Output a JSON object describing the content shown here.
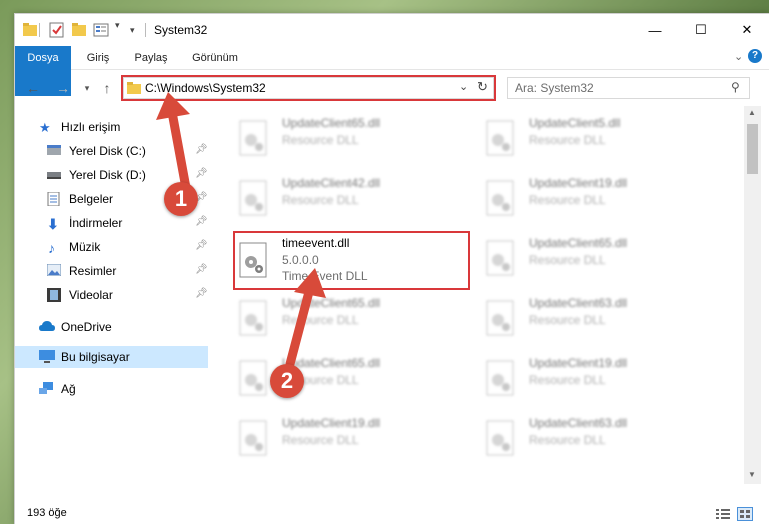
{
  "window": {
    "title": "System32",
    "controls": {
      "minimize": "—",
      "maximize": "☐",
      "close": "✕"
    }
  },
  "ribbon": {
    "tabs": [
      "Dosya",
      "Giriş",
      "Paylaş",
      "Görünüm"
    ]
  },
  "address": {
    "path": "C:\\Windows\\System32",
    "search_placeholder": "Ara: System32"
  },
  "sidebar": {
    "quick_access": "Hızlı erişim",
    "items": [
      {
        "label": "Yerel Disk (C:)",
        "icon": "drive-icon",
        "pinned": true
      },
      {
        "label": "Yerel Disk (D:)",
        "icon": "drive-icon",
        "pinned": true
      },
      {
        "label": "Belgeler",
        "icon": "documents-icon",
        "pinned": true
      },
      {
        "label": "İndirmeler",
        "icon": "download-icon",
        "pinned": true
      },
      {
        "label": "Müzik",
        "icon": "music-icon",
        "pinned": true
      },
      {
        "label": "Resimler",
        "icon": "pictures-icon",
        "pinned": true
      },
      {
        "label": "Videolar",
        "icon": "video-icon",
        "pinned": true
      }
    ],
    "onedrive": "OneDrive",
    "this_pc": "Bu bilgisayar",
    "network": "Ağ"
  },
  "files": [
    {
      "name": "UpdateClient65.dll",
      "line2": "Resource DLL",
      "blurred": true
    },
    {
      "name": "UpdateClient5.dll",
      "line2": "Resource DLL",
      "blurred": true
    },
    {
      "name": "UpdateClient42.dll",
      "line2": "Resource DLL",
      "blurred": true
    },
    {
      "name": "UpdateClient19.dll",
      "line2": "Resource DLL",
      "blurred": true
    },
    {
      "name": "timeevent.dll",
      "line2": "5.0.0.0",
      "line3": "Time Event DLL",
      "blurred": false
    },
    {
      "name": "UpdateClient65.dll",
      "line2": "Resource DLL",
      "blurred": true
    },
    {
      "name": "UpdateClient65.dll",
      "line2": "Resource DLL",
      "blurred": true
    },
    {
      "name": "UpdateClient63.dll",
      "line2": "Resource DLL",
      "blurred": true
    },
    {
      "name": "UpdateClient65.dll",
      "line2": "Resource DLL",
      "blurred": true
    },
    {
      "name": "UpdateClient19.dll",
      "line2": "Resource DLL",
      "blurred": true
    },
    {
      "name": "UpdateClient19.dll",
      "line2": "Resource DLL",
      "blurred": true
    },
    {
      "name": "UpdateClient63.dll",
      "line2": "Resource DLL",
      "blurred": true
    }
  ],
  "callouts": [
    "1",
    "2"
  ],
  "status": {
    "item_count": "193 öğe"
  },
  "colors": {
    "accent": "#1979ca",
    "annotation": "#d9383a",
    "selected": "#cce8ff"
  }
}
